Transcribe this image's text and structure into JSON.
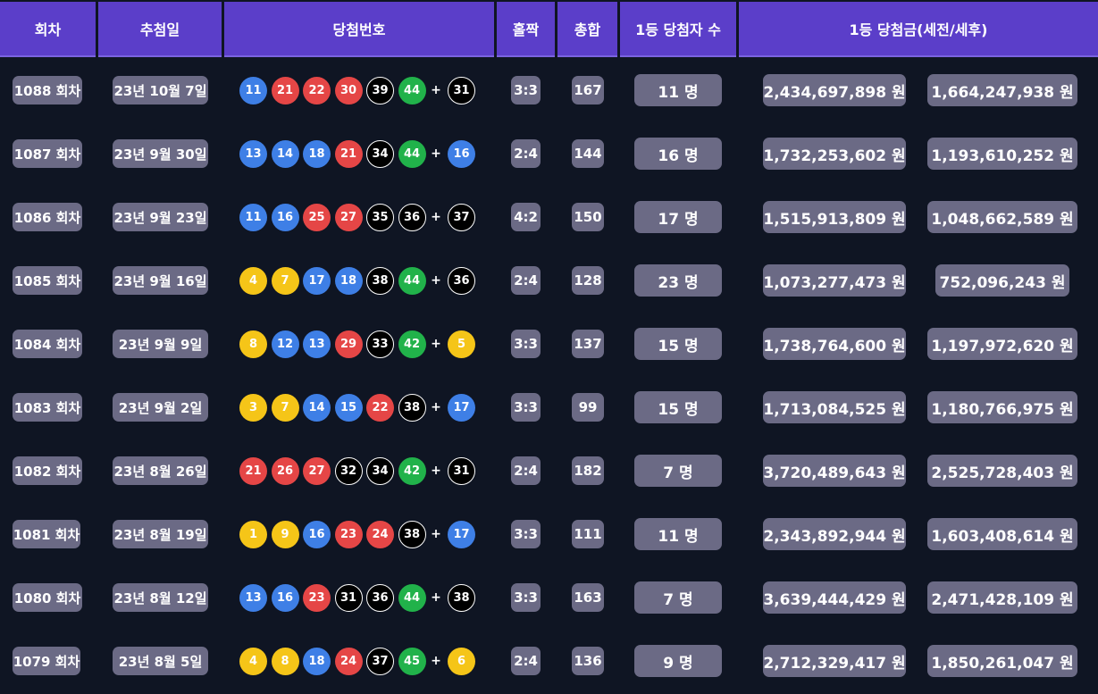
{
  "headers": {
    "round": "회차",
    "date": "추첨일",
    "numbers": "당첨번호",
    "odd_even": "홀짝",
    "sum": "총합",
    "winners": "1등 당첨자 수",
    "prize": "1등 당첨금(세전/세후)"
  },
  "colors": {
    "header_bg": "#5b3ec9",
    "page_bg": "#0f1523",
    "pill_bg": "#6b6a85",
    "ball_yellow": "#f5c518",
    "ball_blue": "#3e7fe6",
    "ball_red": "#e54646",
    "ball_black": "#000000",
    "ball_green": "#21b24a"
  },
  "plus_sign": "+",
  "rows": [
    {
      "round": "1088 회차",
      "date": "23년 10월 7일",
      "numbers": [
        "11",
        "21",
        "22",
        "30",
        "39",
        "44"
      ],
      "bonus": "31",
      "odd_even": "3:3",
      "sum": "167",
      "winners": "11 명",
      "prize_pre": "2,434,697,898 원",
      "prize_post": "1,664,247,938 원"
    },
    {
      "round": "1087 회차",
      "date": "23년 9월 30일",
      "numbers": [
        "13",
        "14",
        "18",
        "21",
        "34",
        "44"
      ],
      "bonus": "16",
      "odd_even": "2:4",
      "sum": "144",
      "winners": "16 명",
      "prize_pre": "1,732,253,602 원",
      "prize_post": "1,193,610,252 원"
    },
    {
      "round": "1086 회차",
      "date": "23년 9월 23일",
      "numbers": [
        "11",
        "16",
        "25",
        "27",
        "35",
        "36"
      ],
      "bonus": "37",
      "odd_even": "4:2",
      "sum": "150",
      "winners": "17 명",
      "prize_pre": "1,515,913,809 원",
      "prize_post": "1,048,662,589 원"
    },
    {
      "round": "1085 회차",
      "date": "23년 9월 16일",
      "numbers": [
        "4",
        "7",
        "17",
        "18",
        "38",
        "44"
      ],
      "bonus": "36",
      "odd_even": "2:4",
      "sum": "128",
      "winners": "23 명",
      "prize_pre": "1,073,277,473 원",
      "prize_post": "752,096,243 원"
    },
    {
      "round": "1084 회차",
      "date": "23년 9월 9일",
      "numbers": [
        "8",
        "12",
        "13",
        "29",
        "33",
        "42"
      ],
      "bonus": "5",
      "odd_even": "3:3",
      "sum": "137",
      "winners": "15 명",
      "prize_pre": "1,738,764,600 원",
      "prize_post": "1,197,972,620 원"
    },
    {
      "round": "1083 회차",
      "date": "23년 9월 2일",
      "numbers": [
        "3",
        "7",
        "14",
        "15",
        "22",
        "38"
      ],
      "bonus": "17",
      "odd_even": "3:3",
      "sum": "99",
      "winners": "15 명",
      "prize_pre": "1,713,084,525 원",
      "prize_post": "1,180,766,975 원"
    },
    {
      "round": "1082 회차",
      "date": "23년 8월 26일",
      "numbers": [
        "21",
        "26",
        "27",
        "32",
        "34",
        "42"
      ],
      "bonus": "31",
      "odd_even": "2:4",
      "sum": "182",
      "winners": "7 명",
      "prize_pre": "3,720,489,643 원",
      "prize_post": "2,525,728,403 원"
    },
    {
      "round": "1081 회차",
      "date": "23년 8월 19일",
      "numbers": [
        "1",
        "9",
        "16",
        "23",
        "24",
        "38"
      ],
      "bonus": "17",
      "odd_even": "3:3",
      "sum": "111",
      "winners": "11 명",
      "prize_pre": "2,343,892,944 원",
      "prize_post": "1,603,408,614 원"
    },
    {
      "round": "1080 회차",
      "date": "23년 8월 12일",
      "numbers": [
        "13",
        "16",
        "23",
        "31",
        "36",
        "44"
      ],
      "bonus": "38",
      "odd_even": "3:3",
      "sum": "163",
      "winners": "7 명",
      "prize_pre": "3,639,444,429 원",
      "prize_post": "2,471,428,109 원"
    },
    {
      "round": "1079 회차",
      "date": "23년 8월 5일",
      "numbers": [
        "4",
        "8",
        "18",
        "24",
        "37",
        "45"
      ],
      "bonus": "6",
      "odd_even": "2:4",
      "sum": "136",
      "winners": "9 명",
      "prize_pre": "2,712,329,417 원",
      "prize_post": "1,850,261,047 원"
    }
  ]
}
